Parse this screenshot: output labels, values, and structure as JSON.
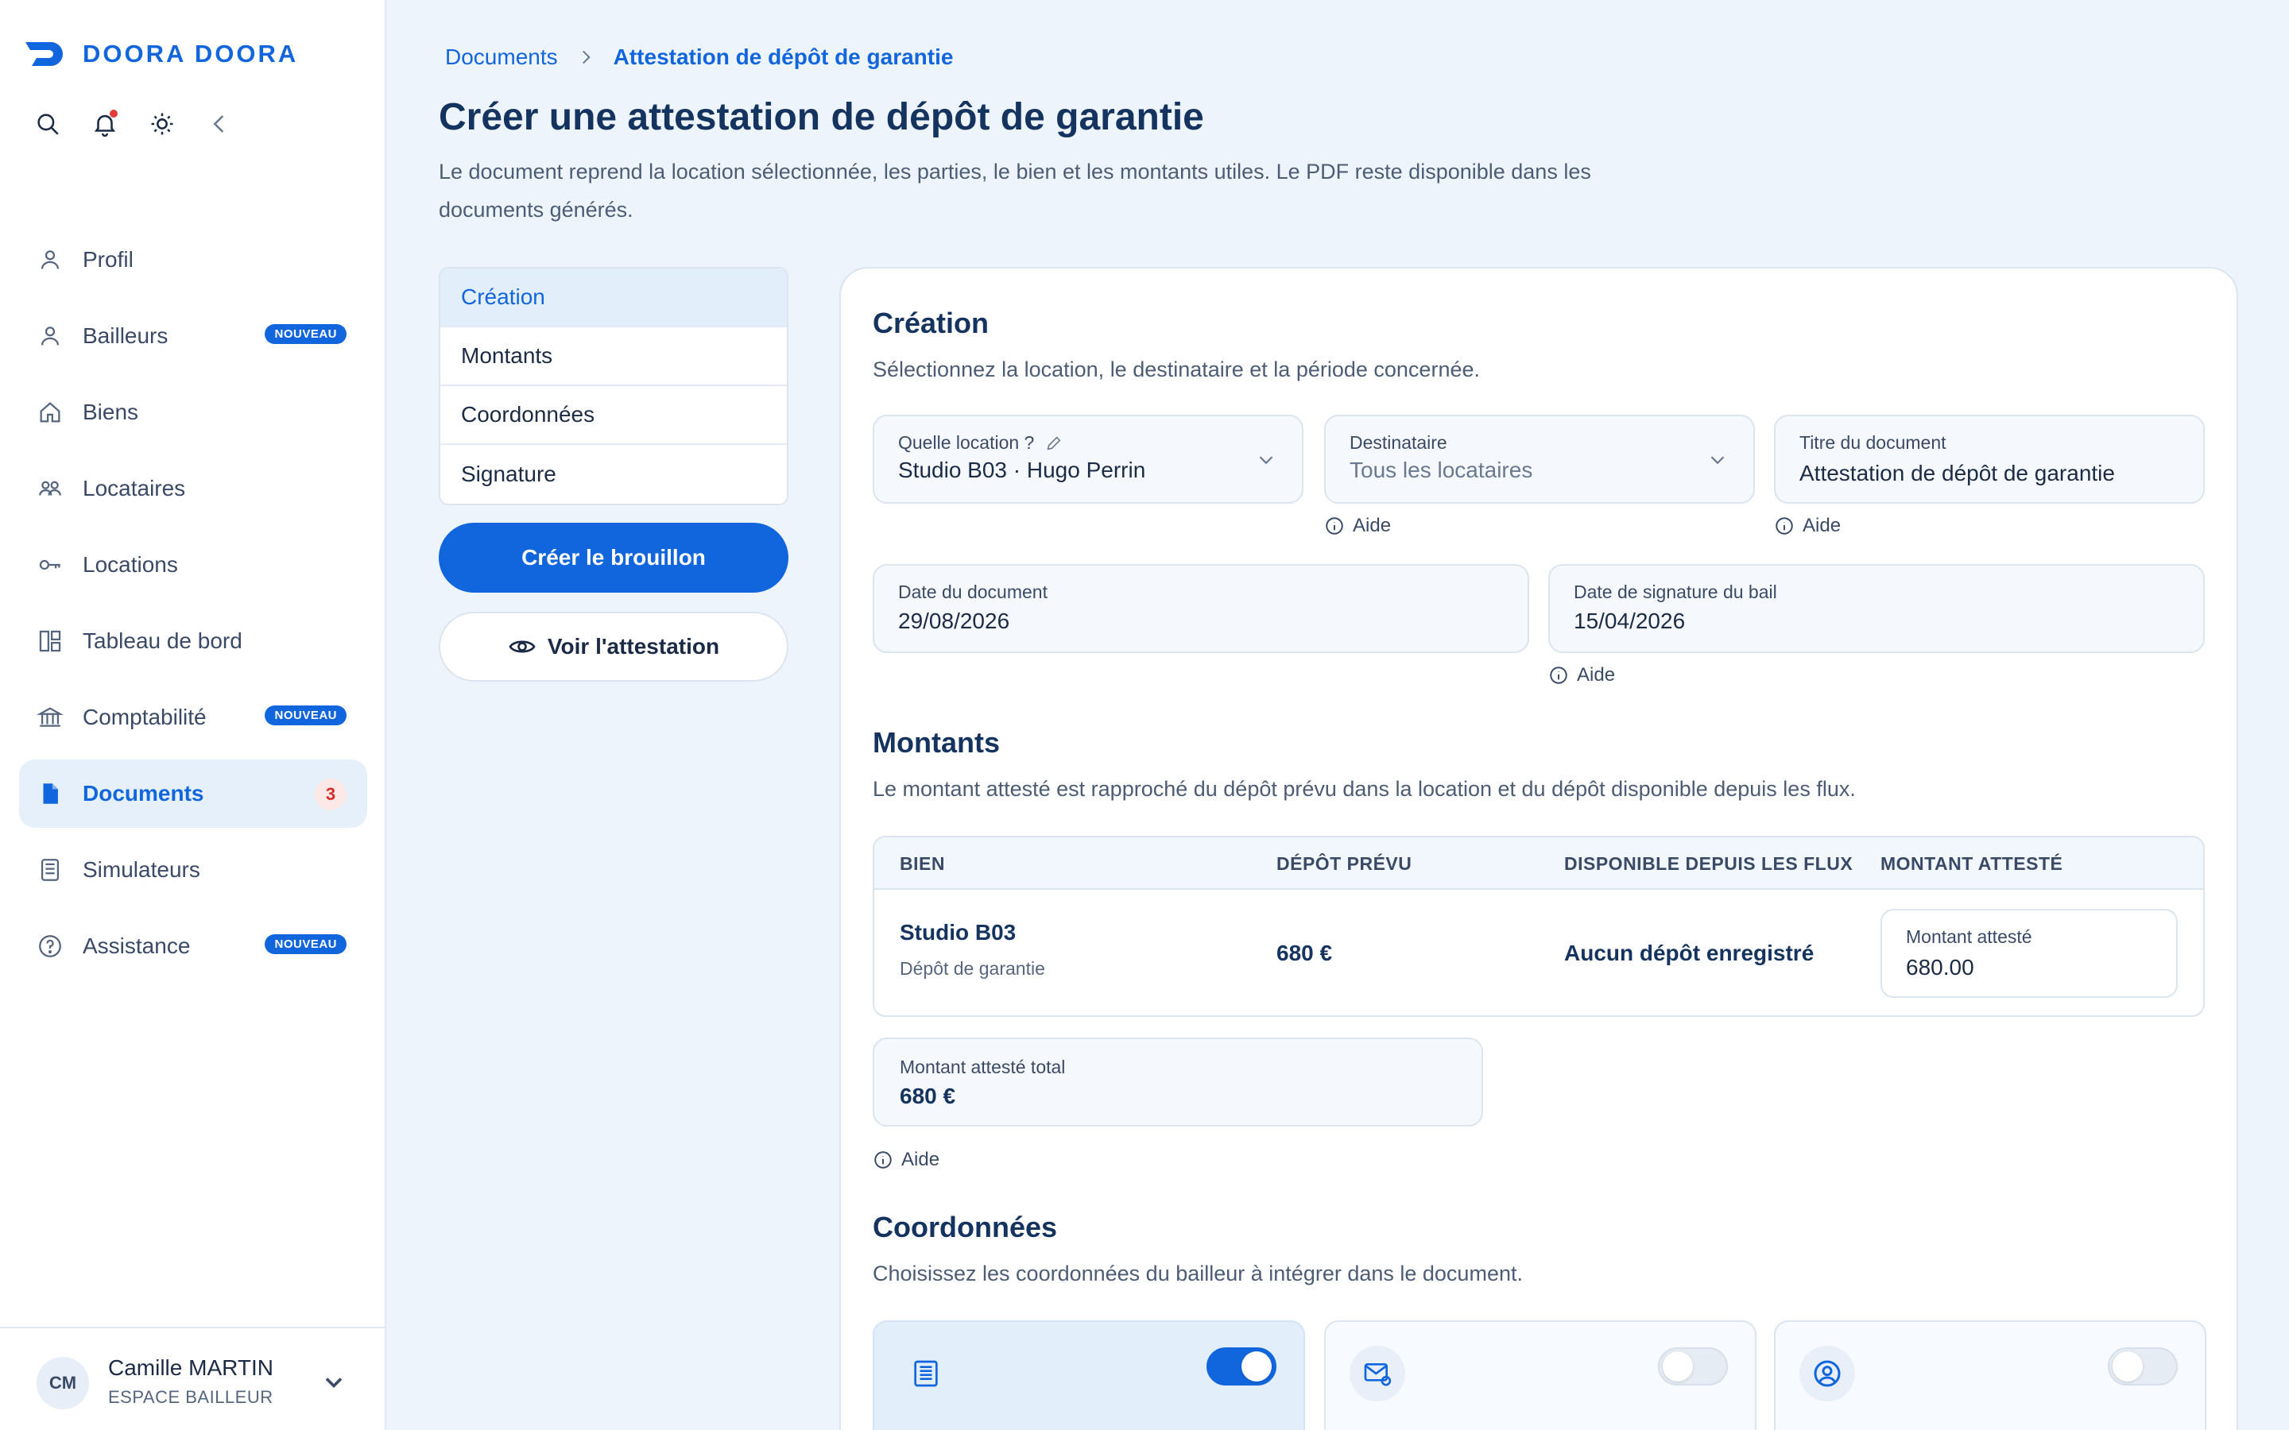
{
  "brand": {
    "name": "DOORA DOORA",
    "color": "#1166dd"
  },
  "toolbar": {
    "icons": [
      "search-icon",
      "bell-icon",
      "sun-icon",
      "collapse-icon"
    ]
  },
  "nav": {
    "items": [
      {
        "label": "Profil",
        "icon": "user-icon"
      },
      {
        "label": "Bailleurs",
        "icon": "user-icon",
        "badge": "NOUVEAU"
      },
      {
        "label": "Biens",
        "icon": "home-icon"
      },
      {
        "label": "Locataires",
        "icon": "users-icon"
      },
      {
        "label": "Locations",
        "icon": "key-icon"
      },
      {
        "label": "Tableau de bord",
        "icon": "dashboard-icon"
      },
      {
        "label": "Comptabilité",
        "icon": "bank-icon",
        "badge": "NOUVEAU"
      },
      {
        "label": "Documents",
        "icon": "document-icon",
        "count": "3",
        "active": true
      },
      {
        "label": "Simulateurs",
        "icon": "calculator-icon"
      },
      {
        "label": "Assistance",
        "icon": "help-icon",
        "badge": "NOUVEAU"
      }
    ]
  },
  "user": {
    "initials": "CM",
    "name": "Camille MARTIN",
    "role": "ESPACE BAILLEUR"
  },
  "breadcrumb": {
    "parent": "Documents",
    "current": "Attestation de dépôt de garantie"
  },
  "page": {
    "title": "Créer une attestation de dépôt de garantie",
    "description": "Le document reprend la location sélectionnée, les parties, le bien et les montants utiles. Le PDF reste disponible dans les documents générés."
  },
  "steps": [
    "Création",
    "Montants",
    "Coordonnées",
    "Signature"
  ],
  "actions": {
    "create_draft": "Créer le brouillon",
    "view": "Voir l'attestation"
  },
  "creation": {
    "title": "Création",
    "description": "Sélectionnez la location, le destinataire et la période concernée.",
    "location": {
      "label": "Quelle location ?",
      "value": "Studio B03 · Hugo Perrin"
    },
    "recipient": {
      "label": "Destinataire",
      "value": "Tous les locataires"
    },
    "doc_title": {
      "label": "Titre du document",
      "value": "Attestation de dépôt de garantie"
    },
    "doc_date": {
      "label": "Date du document",
      "value": "29/08/2026"
    },
    "lease_date": {
      "label": "Date de signature du bail",
      "value": "15/04/2026"
    },
    "help": "Aide"
  },
  "amounts": {
    "title": "Montants",
    "description": "Le montant attesté est rapproché du dépôt prévu dans la location et du dépôt disponible depuis les flux.",
    "columns": [
      "BIEN",
      "DÉPÔT PRÉVU",
      "DISPONIBLE DEPUIS LES FLUX",
      "MONTANT ATTESTÉ"
    ],
    "row": {
      "property": "Studio B03",
      "type": "Dépôt de garantie",
      "planned": "680 €",
      "available": "Aucun dépôt enregistré",
      "attested_label": "Montant attesté",
      "attested_value": "680.00"
    },
    "total_label": "Montant attesté total",
    "total_value": "680 €",
    "help": "Aide"
  },
  "contacts": {
    "title": "Coordonnées",
    "description": "Choisissez les coordonnées du bailleur à intégrer dans le document.",
    "options": [
      {
        "icon": "address-card-icon",
        "enabled": true
      },
      {
        "icon": "mail-icon",
        "enabled": false
      },
      {
        "icon": "profile-icon",
        "enabled": false
      }
    ]
  }
}
